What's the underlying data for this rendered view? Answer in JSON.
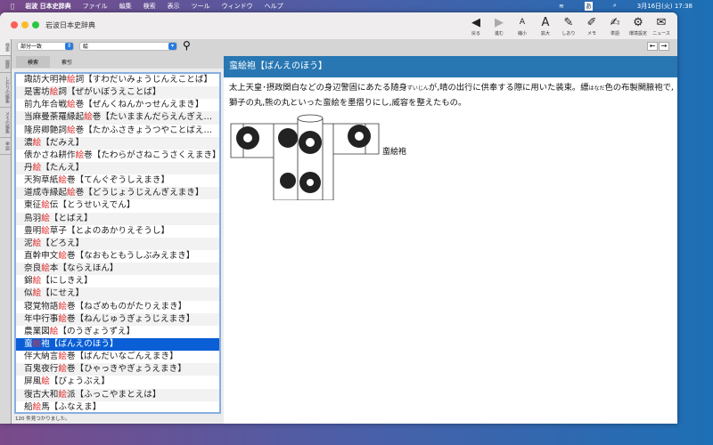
{
  "menubar": {
    "app": "岩波 日本史辞典",
    "items": [
      "ファイル",
      "編集",
      "検索",
      "表示",
      "ツール",
      "ウィンドウ",
      "ヘルプ"
    ],
    "clock": "3月16日(火)  17:38",
    "ime": "あ"
  },
  "window": {
    "title": "岩波日本史辞典"
  },
  "toolbar": [
    {
      "icon": "back-icon",
      "glyph": "◀",
      "label": "戻る"
    },
    {
      "icon": "forward-icon",
      "glyph": "▶",
      "label": "進む"
    },
    {
      "icon": "font-smaller-icon",
      "glyph": "A",
      "label": "縮小"
    },
    {
      "icon": "font-larger-icon",
      "glyph": "A",
      "label": "拡大"
    },
    {
      "icon": "bookmark-icon",
      "glyph": "✎",
      "label": "しおり"
    },
    {
      "icon": "memo-icon",
      "glyph": "✐",
      "label": "メモ"
    },
    {
      "icon": "wordbook-icon",
      "glyph": "✍",
      "label": "単語"
    },
    {
      "icon": "gear-icon",
      "glyph": "⚙",
      "label": "環境設定"
    },
    {
      "icon": "news-icon",
      "glyph": "✉",
      "label": "ニュース"
    }
  ],
  "vtabs": [
    "検索",
    "履歴",
    "しおりの編集",
    "メモの編集",
    "単語"
  ],
  "search": {
    "mode": "部分一致",
    "query": "絵",
    "tabs": [
      "検索",
      "索引"
    ]
  },
  "list": [
    {
      "pre": "諏訪大明神",
      "hit": "絵",
      "post": "詞【すわだいみょうじんえことば】"
    },
    {
      "pre": "是害坊",
      "hit": "絵",
      "post": "詞【ぜがいぼうえことば】"
    },
    {
      "pre": "前九年合戦",
      "hit": "絵",
      "post": "巻【ぜんくねんかっせんえまき】"
    },
    {
      "pre": "当麻曼荼羅縁起",
      "hit": "絵",
      "post": "巻【たいままんだらえんぎえ…"
    },
    {
      "pre": "隆房卿艶詞",
      "hit": "絵",
      "post": "巻【たかふさきょうつやことばえ…"
    },
    {
      "pre": "濃",
      "hit": "絵",
      "post": "【だみえ】"
    },
    {
      "pre": "俵かさね耕作",
      "hit": "絵",
      "post": "巻【たわらがさねこうさくえまき】"
    },
    {
      "pre": "丹",
      "hit": "絵",
      "post": "【たんえ】"
    },
    {
      "pre": "天狗草紙",
      "hit": "絵",
      "post": "巻【てんぐぞうしえまき】"
    },
    {
      "pre": "道成寺縁起",
      "hit": "絵",
      "post": "巻【どうじょうじえんぎえまき】"
    },
    {
      "pre": "東征",
      "hit": "絵",
      "post": "伝【とうせいえでん】"
    },
    {
      "pre": "鳥羽",
      "hit": "絵",
      "post": "【とばえ】"
    },
    {
      "pre": "豊明",
      "hit": "絵",
      "post": "草子【とよのあかりえそうし】"
    },
    {
      "pre": "泥",
      "hit": "絵",
      "post": "【どろえ】"
    },
    {
      "pre": "直幹申文",
      "hit": "絵",
      "post": "巻【なおもともうしぶみえまき】"
    },
    {
      "pre": "奈良",
      "hit": "絵",
      "post": "本【ならえほん】"
    },
    {
      "pre": "錦",
      "hit": "絵",
      "post": "【にしきえ】"
    },
    {
      "pre": "似",
      "hit": "絵",
      "post": "【にせえ】"
    },
    {
      "pre": "寝覚物語",
      "hit": "絵",
      "post": "巻【ねざめものがたりえまき】"
    },
    {
      "pre": "年中行事",
      "hit": "絵",
      "post": "巻【ねんじゅうぎょうじえまき】"
    },
    {
      "pre": "農業図",
      "hit": "絵",
      "post": "【のうぎょうずえ】"
    },
    {
      "pre": "蛮",
      "hit": "絵",
      "post": "袍【ばんえのほう】"
    },
    {
      "pre": "伴大納言",
      "hit": "絵",
      "post": "巻【ばんだいなごんえまき】"
    },
    {
      "pre": "百鬼夜行",
      "hit": "絵",
      "post": "巻【ひゃっきやぎょうえまき】"
    },
    {
      "pre": "屏風",
      "hit": "絵",
      "post": "【びょうぶえ】"
    },
    {
      "pre": "復古大和",
      "hit": "絵",
      "post": "派【ふっこやまとえは】"
    },
    {
      "pre": "船",
      "hit": "絵",
      "post": "馬【ふなえま】"
    }
  ],
  "selected_index": 21,
  "status": "120 件見つかりました。",
  "entry": {
    "title": "蛮絵袍【ばんえのほう】",
    "body1": "太上天皇･摂政関白などの身辺警固にあたる随身",
    "ruby1": "ずいじん",
    "body2": "が,晴の出行に供奉する際に用いた装束。縹",
    "ruby2": "はなだ",
    "body3": "色の布製闕腋袍で,獅子の丸,熊の丸といった蛮絵を墨摺りにし,威容を整えたもの。",
    "caption": "蛮絵袍"
  },
  "colors": {
    "accent": "#2877b3",
    "selection": "#0a5fd6",
    "hit": "#e02020"
  }
}
